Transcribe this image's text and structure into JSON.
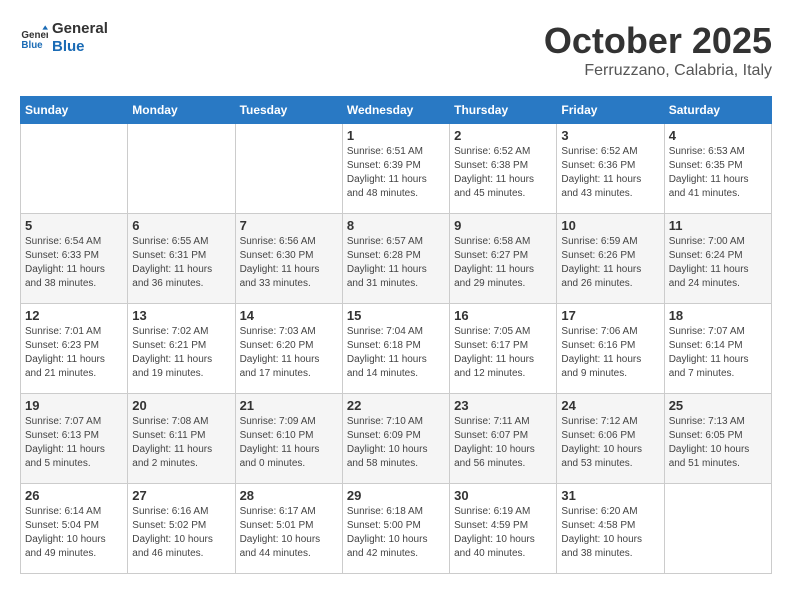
{
  "header": {
    "logo_line1": "General",
    "logo_line2": "Blue",
    "month": "October 2025",
    "location": "Ferruzzano, Calabria, Italy"
  },
  "weekdays": [
    "Sunday",
    "Monday",
    "Tuesday",
    "Wednesday",
    "Thursday",
    "Friday",
    "Saturday"
  ],
  "weeks": [
    [
      {
        "day": "",
        "info": ""
      },
      {
        "day": "",
        "info": ""
      },
      {
        "day": "",
        "info": ""
      },
      {
        "day": "1",
        "info": "Sunrise: 6:51 AM\nSunset: 6:39 PM\nDaylight: 11 hours\nand 48 minutes."
      },
      {
        "day": "2",
        "info": "Sunrise: 6:52 AM\nSunset: 6:38 PM\nDaylight: 11 hours\nand 45 minutes."
      },
      {
        "day": "3",
        "info": "Sunrise: 6:52 AM\nSunset: 6:36 PM\nDaylight: 11 hours\nand 43 minutes."
      },
      {
        "day": "4",
        "info": "Sunrise: 6:53 AM\nSunset: 6:35 PM\nDaylight: 11 hours\nand 41 minutes."
      }
    ],
    [
      {
        "day": "5",
        "info": "Sunrise: 6:54 AM\nSunset: 6:33 PM\nDaylight: 11 hours\nand 38 minutes."
      },
      {
        "day": "6",
        "info": "Sunrise: 6:55 AM\nSunset: 6:31 PM\nDaylight: 11 hours\nand 36 minutes."
      },
      {
        "day": "7",
        "info": "Sunrise: 6:56 AM\nSunset: 6:30 PM\nDaylight: 11 hours\nand 33 minutes."
      },
      {
        "day": "8",
        "info": "Sunrise: 6:57 AM\nSunset: 6:28 PM\nDaylight: 11 hours\nand 31 minutes."
      },
      {
        "day": "9",
        "info": "Sunrise: 6:58 AM\nSunset: 6:27 PM\nDaylight: 11 hours\nand 29 minutes."
      },
      {
        "day": "10",
        "info": "Sunrise: 6:59 AM\nSunset: 6:26 PM\nDaylight: 11 hours\nand 26 minutes."
      },
      {
        "day": "11",
        "info": "Sunrise: 7:00 AM\nSunset: 6:24 PM\nDaylight: 11 hours\nand 24 minutes."
      }
    ],
    [
      {
        "day": "12",
        "info": "Sunrise: 7:01 AM\nSunset: 6:23 PM\nDaylight: 11 hours\nand 21 minutes."
      },
      {
        "day": "13",
        "info": "Sunrise: 7:02 AM\nSunset: 6:21 PM\nDaylight: 11 hours\nand 19 minutes."
      },
      {
        "day": "14",
        "info": "Sunrise: 7:03 AM\nSunset: 6:20 PM\nDaylight: 11 hours\nand 17 minutes."
      },
      {
        "day": "15",
        "info": "Sunrise: 7:04 AM\nSunset: 6:18 PM\nDaylight: 11 hours\nand 14 minutes."
      },
      {
        "day": "16",
        "info": "Sunrise: 7:05 AM\nSunset: 6:17 PM\nDaylight: 11 hours\nand 12 minutes."
      },
      {
        "day": "17",
        "info": "Sunrise: 7:06 AM\nSunset: 6:16 PM\nDaylight: 11 hours\nand 9 minutes."
      },
      {
        "day": "18",
        "info": "Sunrise: 7:07 AM\nSunset: 6:14 PM\nDaylight: 11 hours\nand 7 minutes."
      }
    ],
    [
      {
        "day": "19",
        "info": "Sunrise: 7:07 AM\nSunset: 6:13 PM\nDaylight: 11 hours\nand 5 minutes."
      },
      {
        "day": "20",
        "info": "Sunrise: 7:08 AM\nSunset: 6:11 PM\nDaylight: 11 hours\nand 2 minutes."
      },
      {
        "day": "21",
        "info": "Sunrise: 7:09 AM\nSunset: 6:10 PM\nDaylight: 11 hours\nand 0 minutes."
      },
      {
        "day": "22",
        "info": "Sunrise: 7:10 AM\nSunset: 6:09 PM\nDaylight: 10 hours\nand 58 minutes."
      },
      {
        "day": "23",
        "info": "Sunrise: 7:11 AM\nSunset: 6:07 PM\nDaylight: 10 hours\nand 56 minutes."
      },
      {
        "day": "24",
        "info": "Sunrise: 7:12 AM\nSunset: 6:06 PM\nDaylight: 10 hours\nand 53 minutes."
      },
      {
        "day": "25",
        "info": "Sunrise: 7:13 AM\nSunset: 6:05 PM\nDaylight: 10 hours\nand 51 minutes."
      }
    ],
    [
      {
        "day": "26",
        "info": "Sunrise: 6:14 AM\nSunset: 5:04 PM\nDaylight: 10 hours\nand 49 minutes."
      },
      {
        "day": "27",
        "info": "Sunrise: 6:16 AM\nSunset: 5:02 PM\nDaylight: 10 hours\nand 46 minutes."
      },
      {
        "day": "28",
        "info": "Sunrise: 6:17 AM\nSunset: 5:01 PM\nDaylight: 10 hours\nand 44 minutes."
      },
      {
        "day": "29",
        "info": "Sunrise: 6:18 AM\nSunset: 5:00 PM\nDaylight: 10 hours\nand 42 minutes."
      },
      {
        "day": "30",
        "info": "Sunrise: 6:19 AM\nSunset: 4:59 PM\nDaylight: 10 hours\nand 40 minutes."
      },
      {
        "day": "31",
        "info": "Sunrise: 6:20 AM\nSunset: 4:58 PM\nDaylight: 10 hours\nand 38 minutes."
      },
      {
        "day": "",
        "info": ""
      }
    ]
  ]
}
